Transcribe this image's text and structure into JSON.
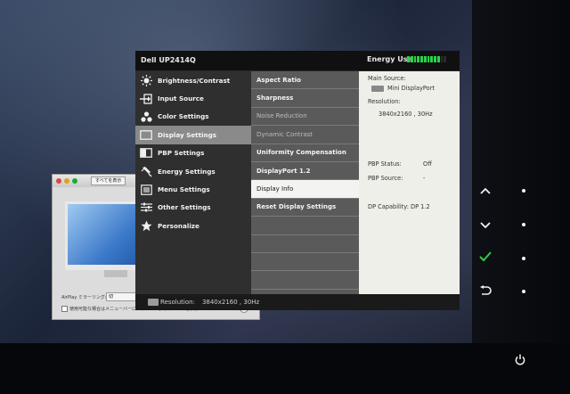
{
  "mac_window": {
    "show_all": "すべてを表示",
    "mirroring_label": "AirPlay ミラーリング:",
    "mirroring_value": "切",
    "checkbox_label": "使用可能な場合はメニューバーにミラーリングオプションを表示",
    "help_label": "?"
  },
  "osd": {
    "model": "Dell UP2414Q",
    "energy_label": "Energy Use",
    "energy_level": 0.85,
    "main_menu": [
      {
        "label": "Brightness/Contrast",
        "icon": "sun-icon"
      },
      {
        "label": "Input Source",
        "icon": "input-arrow-icon"
      },
      {
        "label": "Color Settings",
        "icon": "color-dots-icon"
      },
      {
        "label": "Display Settings",
        "icon": "display-rect-icon",
        "selected": true
      },
      {
        "label": "PBP Settings",
        "icon": "pbp-icon"
      },
      {
        "label": "Energy Settings",
        "icon": "plug-icon"
      },
      {
        "label": "Menu Settings",
        "icon": "menu-list-icon"
      },
      {
        "label": "Other Settings",
        "icon": "sliders-icon"
      },
      {
        "label": "Personalize",
        "icon": "star-icon"
      }
    ],
    "sub_menu": [
      {
        "label": "Aspect Ratio"
      },
      {
        "label": "Sharpness"
      },
      {
        "label": "Noise Reduction",
        "dim": true
      },
      {
        "label": "Dynamic Contrast",
        "dim": true
      },
      {
        "label": "Uniformity Compensation"
      },
      {
        "label": "DisplayPort 1.2"
      },
      {
        "label": "Display Info",
        "selected": true
      },
      {
        "label": "Reset Display Settings"
      },
      {
        "label": ""
      },
      {
        "label": ""
      },
      {
        "label": ""
      },
      {
        "label": ""
      }
    ],
    "info": {
      "main_source_label": "Main Source:",
      "main_source_value": "Mini DisplayPort",
      "resolution_label": "Resolution:",
      "resolution_value": "3840x2160 , 30Hz",
      "pbp_status_label": "PBP Status:",
      "pbp_status_value": "Off",
      "pbp_source_label": "PBP Source:",
      "pbp_source_value": "-",
      "dp_capability": "DP Capability: DP 1.2"
    },
    "footer": {
      "resolution_label": "Resolution:",
      "resolution_value": "3840x2160 , 30Hz"
    }
  },
  "side_buttons": [
    {
      "symbol": "⌃",
      "icon": "up-arrow-icon"
    },
    {
      "symbol": "⌄",
      "icon": "down-arrow-icon"
    },
    {
      "symbol": "✓",
      "icon": "check-icon",
      "color": "#2ecc40"
    },
    {
      "symbol": "⮌",
      "icon": "back-icon"
    },
    {
      "symbol": "⏻",
      "icon": "power-icon"
    }
  ],
  "colors": {
    "energy_on": "#27d44a",
    "check_green": "#2ecc40",
    "osd_panel": "#efefe9"
  }
}
